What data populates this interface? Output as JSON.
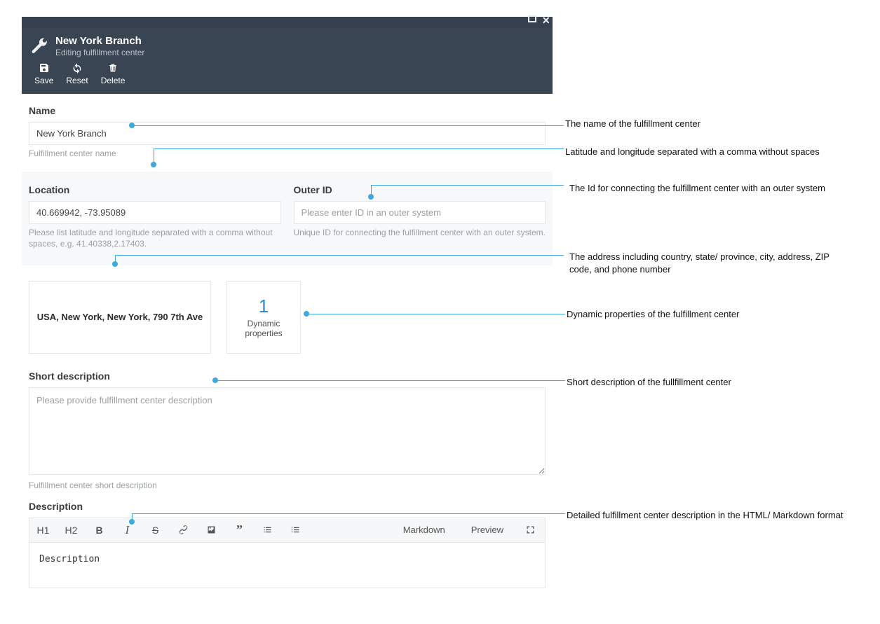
{
  "windowControls": {
    "maximize": "maximize",
    "close": "close"
  },
  "header": {
    "title": "New York Branch",
    "subtitle": "Editing fulfillment center"
  },
  "toolbar": {
    "save": "Save",
    "reset": "Reset",
    "delete": "Delete"
  },
  "form": {
    "name": {
      "label": "Name",
      "value": "New York Branch",
      "help": "Fulfillment center name"
    },
    "location": {
      "label": "Location",
      "value": "40.669942, -73.95089",
      "help": "Please list latitude and longitude separated with a comma without spaces, e.g. 41.40338,2.17403."
    },
    "outerId": {
      "label": "Outer ID",
      "placeholder": "Please enter ID in an outer system",
      "help": "Unique ID for connecting the fulfillment center with an outer system."
    },
    "addressCard": {
      "text": "USA, New York, New York, 790 7th Ave"
    },
    "dynamicCard": {
      "count": "1",
      "caption": "Dynamic properties"
    },
    "shortDesc": {
      "label": "Short description",
      "placeholder": "Please provide fulfillment center description",
      "help": "Fulfillment center short description"
    },
    "description": {
      "label": "Description",
      "body": "Description"
    }
  },
  "editorToolbar": {
    "h1": "H1",
    "h2": "H2",
    "bold": "B",
    "italic": "I",
    "strike": "S",
    "markdown": "Markdown",
    "preview": "Preview"
  },
  "annotations": {
    "name": "The name of the fulfillment center",
    "location": "Latitude and longitude separated with a comma without spaces",
    "outerId": "The Id for connecting the fulfillment center with an outer system",
    "address": "The address including country, state/ province, city, address, ZIP code, and phone number",
    "dynamic": "Dynamic properties of the fulfillment center",
    "shortDesc": "Short description of the fullfillment center",
    "desc": "Detailed fulfillment center description in the HTML/ Markdown format"
  }
}
